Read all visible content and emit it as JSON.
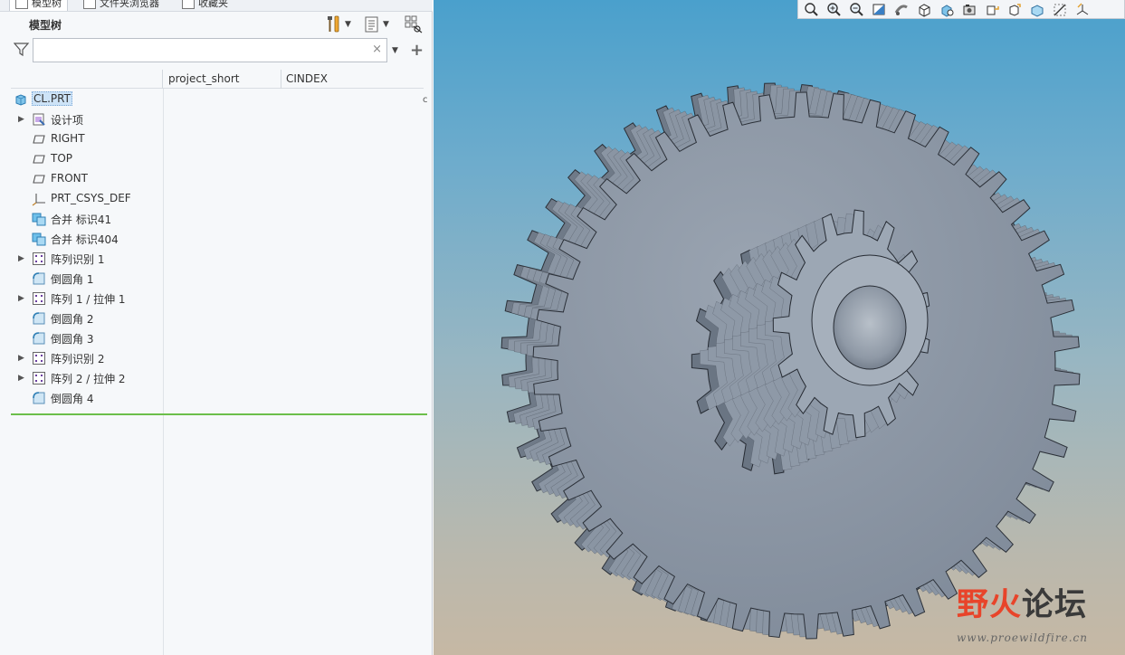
{
  "tabs": [
    {
      "label": "模型树",
      "active": true
    },
    {
      "label": "文件夹浏览器",
      "active": false
    },
    {
      "label": "收藏夹",
      "active": false
    }
  ],
  "panel": {
    "title": "模型树",
    "search": {
      "value": "",
      "placeholder": ""
    },
    "clear_symbol": "×",
    "add_symbol": "+"
  },
  "columns": [
    "project_short",
    "CINDEX"
  ],
  "tree": {
    "root": {
      "label": "CL.PRT",
      "icon": "part-icon"
    },
    "items": [
      {
        "label": "设计项",
        "icon": "design-items-icon",
        "expandable": true
      },
      {
        "label": "RIGHT",
        "icon": "datum-plane-icon",
        "expandable": false
      },
      {
        "label": "TOP",
        "icon": "datum-plane-icon",
        "expandable": false
      },
      {
        "label": "FRONT",
        "icon": "datum-plane-icon",
        "expandable": false
      },
      {
        "label": "PRT_CSYS_DEF",
        "icon": "csys-icon",
        "expandable": false
      },
      {
        "label": "合并 标识41",
        "icon": "merge-icon",
        "expandable": false
      },
      {
        "label": "合并 标识404",
        "icon": "merge-icon",
        "expandable": false
      },
      {
        "label": "阵列识别 1",
        "icon": "pattern-icon",
        "expandable": true
      },
      {
        "label": "倒圆角 1",
        "icon": "round-icon",
        "expandable": false
      },
      {
        "label": "阵列 1 / 拉伸 1",
        "icon": "pattern-icon",
        "expandable": true
      },
      {
        "label": "倒圆角 2",
        "icon": "round-icon",
        "expandable": false
      },
      {
        "label": "倒圆角 3",
        "icon": "round-icon",
        "expandable": false
      },
      {
        "label": "阵列识别 2",
        "icon": "pattern-icon",
        "expandable": true
      },
      {
        "label": "阵列 2 / 拉伸 2",
        "icon": "pattern-icon",
        "expandable": true
      },
      {
        "label": "倒圆角 4",
        "icon": "round-icon",
        "expandable": false
      }
    ]
  },
  "view_toolbar": [
    "refit-icon",
    "zoom-in-icon",
    "zoom-out-icon",
    "repaint-icon",
    "saved-orientations-icon",
    "display-style-icon",
    "appearance-icon",
    "named-views-icon",
    "spin-center-icon",
    "datum-display-icon",
    "section-view-icon",
    "annotation-display-icon",
    "csys-display-icon"
  ],
  "colors": {
    "accent": "#6cbf4a",
    "selection": "#cde3f7",
    "gear": "#8d98a6"
  },
  "watermark": {
    "main_a": "野火",
    "main_b": "论坛",
    "url": "www.proewildfire.cn"
  }
}
